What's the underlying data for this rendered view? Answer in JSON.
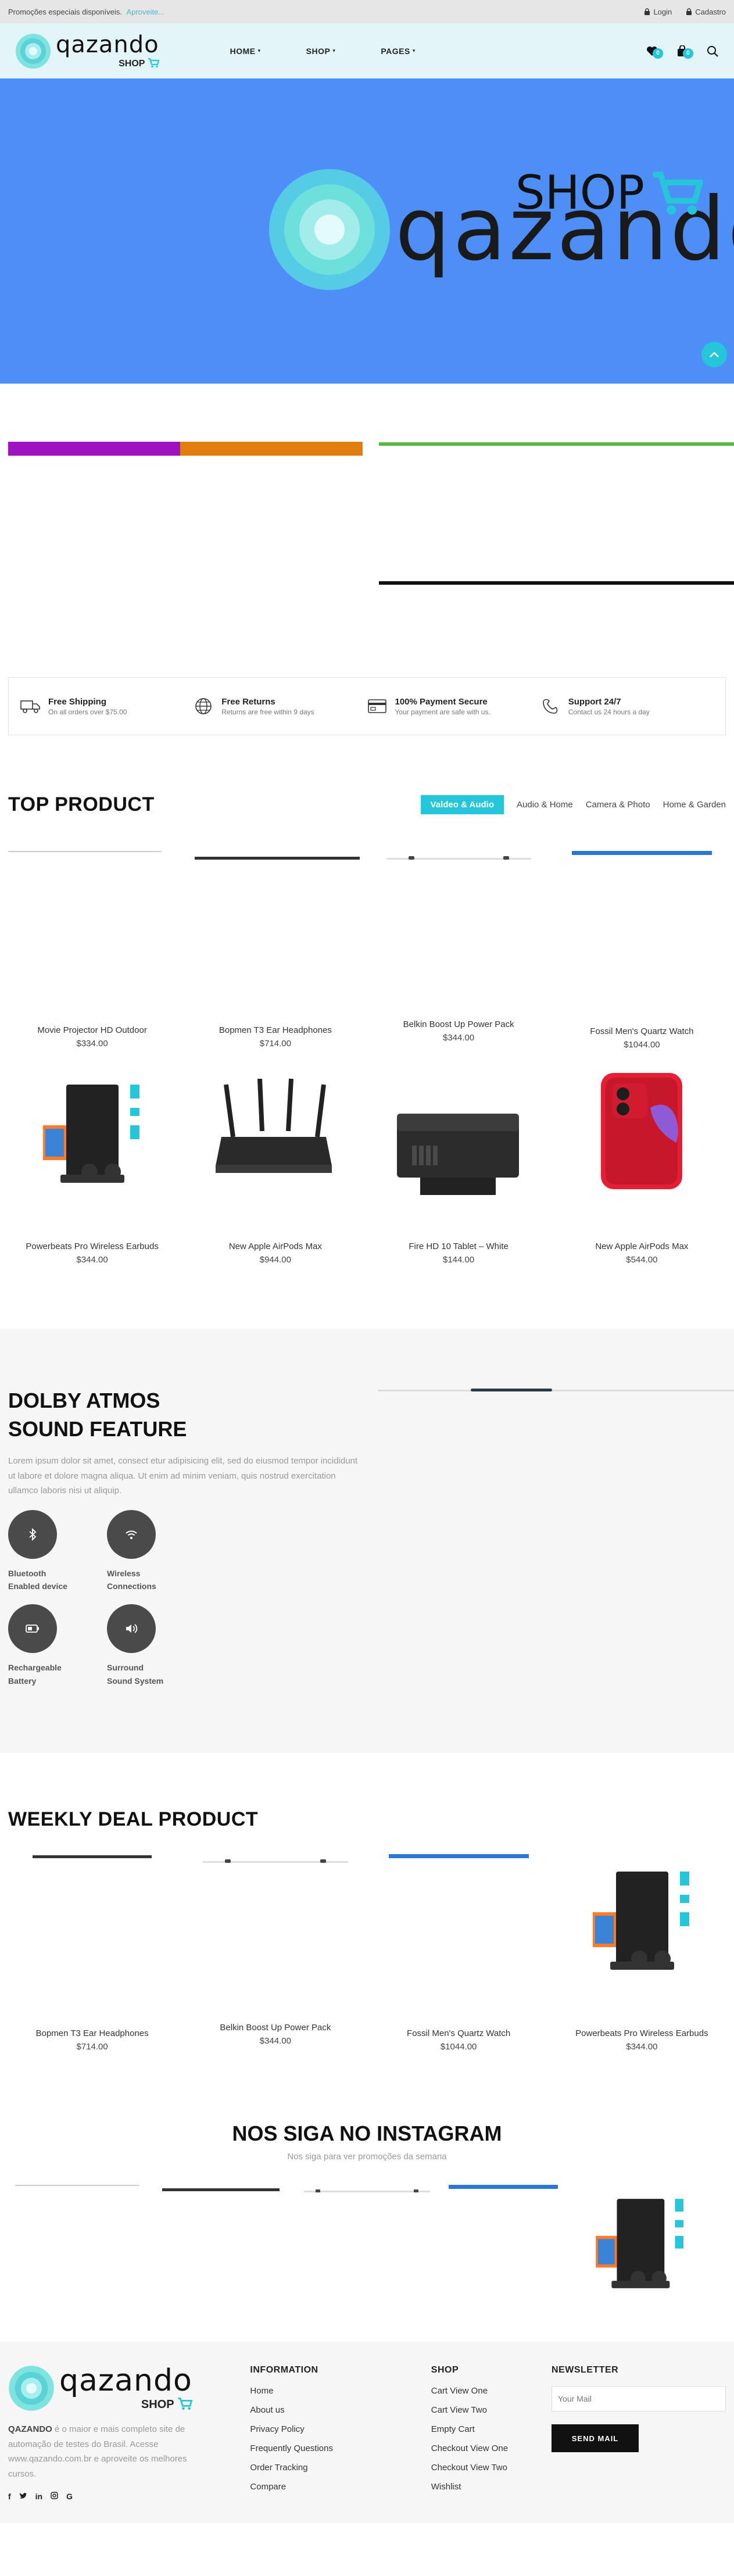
{
  "topbar": {
    "promo_text": "Promoções especiais disponíveis.",
    "promo_link": "Aproveite...",
    "login": "Login",
    "register": "Cadastro"
  },
  "header": {
    "logo_text": "qazando",
    "logo_shop": "SHOP",
    "nav": [
      "HOME",
      "SHOP",
      "PAGES"
    ],
    "wishlist_count": "0",
    "cart_count": "0"
  },
  "hero": {
    "logo_text": "qazando",
    "logo_shop": "SHOP"
  },
  "features": [
    {
      "title": "Free Shipping",
      "sub": "On all orders over $75.00",
      "icon": "truck-icon"
    },
    {
      "title": "Free Returns",
      "sub": "Returns are free within 9 days",
      "icon": "globe-icon"
    },
    {
      "title": "100% Payment Secure",
      "sub": "Your payment are safe with us.",
      "icon": "card-icon"
    },
    {
      "title": "Support 24/7",
      "sub": "Contact us 24 hours a day",
      "icon": "support-icon"
    }
  ],
  "top_product": {
    "title": "TOP PRODUCT",
    "tabs": [
      "Valdeo & Audio",
      "Audio & Home",
      "Camera & Photo",
      "Home & Garden"
    ],
    "products": [
      {
        "name": "Movie Projector HD Outdoor",
        "price": "$334.00"
      },
      {
        "name": "Bopmen T3 Ear Headphones",
        "price": "$714.00"
      },
      {
        "name": "Belkin Boost Up Power Pack",
        "price": "$344.00"
      },
      {
        "name": "Fossil Men's Quartz Watch",
        "price": "$1044.00"
      },
      {
        "name": "Powerbeats Pro Wireless Earbuds",
        "price": "$344.00"
      },
      {
        "name": "New Apple AirPods Max",
        "price": "$944.00"
      },
      {
        "name": "Fire HD 10 Tablet – White",
        "price": "$144.00"
      },
      {
        "name": "New Apple AirPods Max",
        "price": "$544.00"
      }
    ]
  },
  "dolby": {
    "title_line1": "DOLBY ATMOS",
    "title_line2": "SOUND FEATURE",
    "text": "Lorem ipsum dolor sit amet, consect etur adipisicing elit, sed do eiusmod tempor incididunt ut labore et dolore magna aliqua. Ut enim ad minim veniam, quis nostrud exercitation ullamco laboris nisi ut aliquip.",
    "features": [
      {
        "line1": "Bluetooth",
        "line2": "Enabled device",
        "icon": "bluetooth-icon"
      },
      {
        "line1": "Wireless",
        "line2": "Connections",
        "icon": "wifi-icon"
      },
      {
        "line1": "Rechargeable",
        "line2": "Battery",
        "icon": "battery-icon"
      },
      {
        "line1": "Surround",
        "line2": "Sound System",
        "icon": "speaker-icon"
      }
    ]
  },
  "weekly": {
    "title": "WEEKLY DEAL PRODUCT",
    "products": [
      {
        "name": "Bopmen T3 Ear Headphones",
        "price": "$714.00"
      },
      {
        "name": "Belkin Boost Up Power Pack",
        "price": "$344.00"
      },
      {
        "name": "Fossil Men's Quartz Watch",
        "price": "$1044.00"
      },
      {
        "name": "Powerbeats Pro Wireless Earbuds",
        "price": "$344.00"
      }
    ]
  },
  "instagram": {
    "title": "NOS SIGA NO INSTAGRAM",
    "subtitle": "Nos siga para ver promoções da semana"
  },
  "footer": {
    "brand_name": "QAZANDO",
    "brand_desc": "é o maior e mais completo site de automação de testes do Brasil. Acesse www.qazando.com.br e aproveite os melhores cursos.",
    "information_heading": "INFORMATION",
    "information_links": [
      "Home",
      "About us",
      "Privacy Policy",
      "Frequently Questions",
      "Order Tracking",
      "Compare"
    ],
    "shop_heading": "SHOP",
    "shop_links": [
      "Cart View One",
      "Cart View Two",
      "Empty Cart",
      "Checkout View One",
      "Checkout View Two",
      "Wishlist"
    ],
    "newsletter_heading": "NEWSLETTER",
    "newsletter_placeholder": "Your Mail",
    "newsletter_button": "SEND MAIL"
  },
  "colors": {
    "accent": "#25c6d9",
    "hero_bg": "#4d8ff7",
    "header_bg": "#e3f5f8"
  }
}
